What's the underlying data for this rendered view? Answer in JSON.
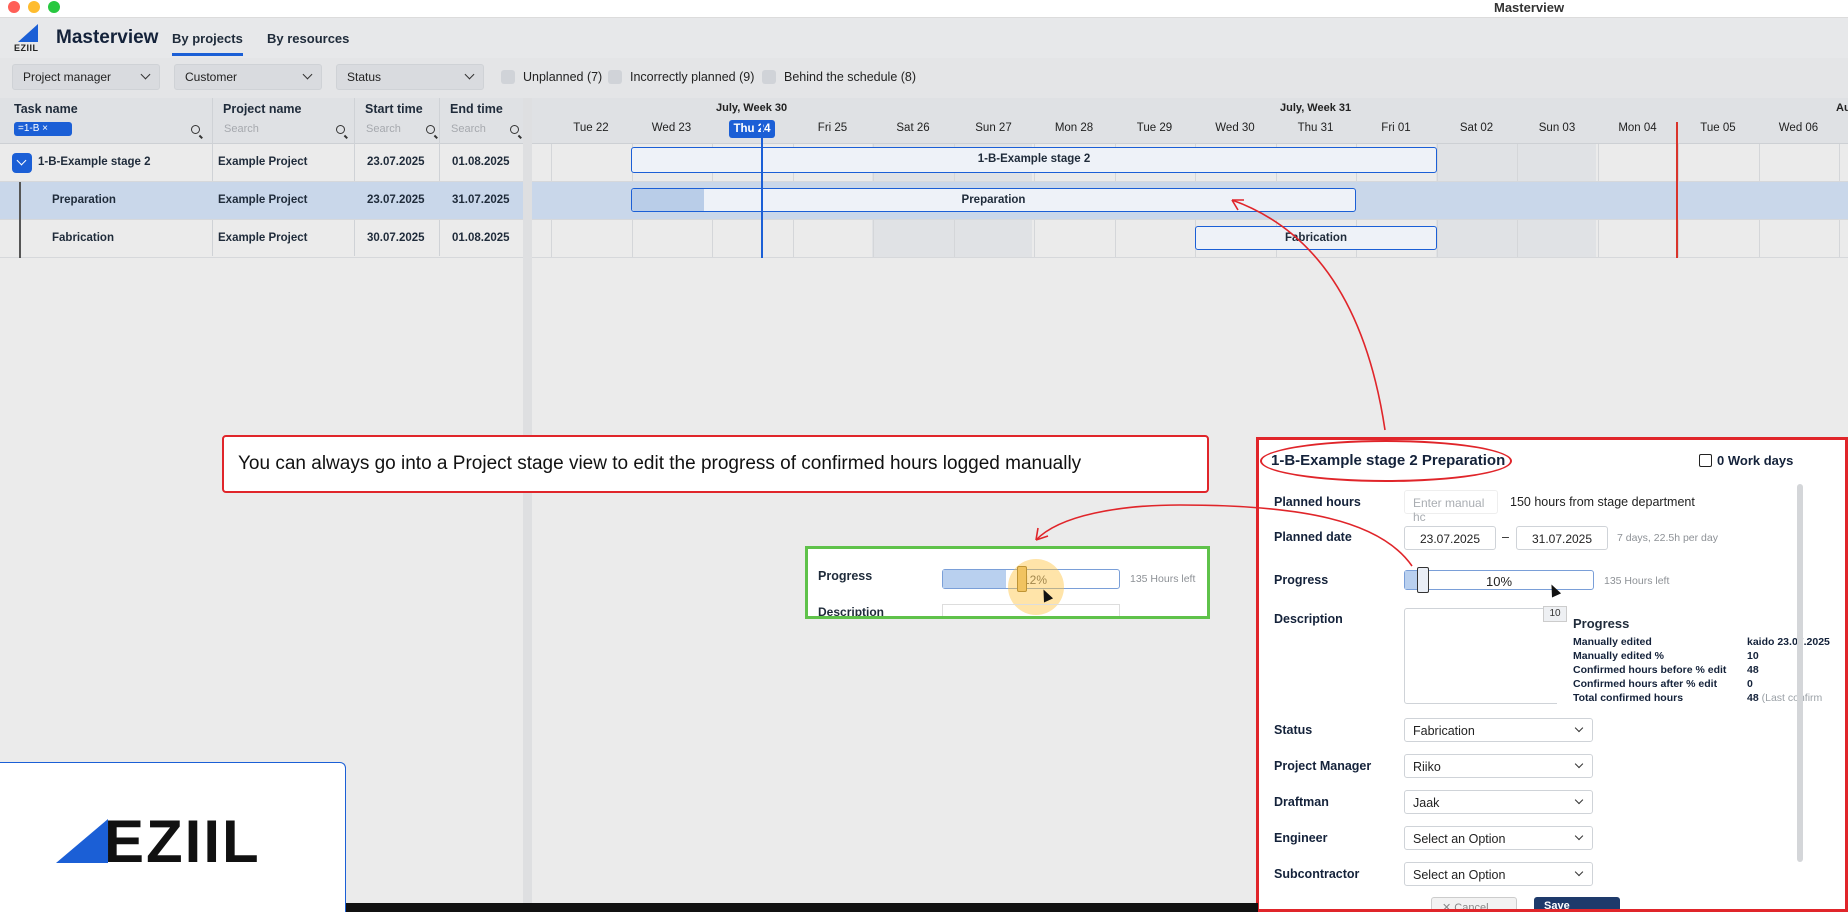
{
  "window": {
    "title": "Masterview"
  },
  "app": {
    "logo_text": "EZIIL",
    "title": "Masterview",
    "tabs": [
      "By projects",
      "By resources"
    ]
  },
  "filters": {
    "project_manager": "Project manager",
    "customer": "Customer",
    "status": "Status",
    "checks": [
      "Unplanned (7)",
      "Incorrectly planned (9)",
      "Behind the schedule (8)"
    ]
  },
  "grid": {
    "columns": [
      "Task name",
      "Project name",
      "Start time",
      "End time"
    ],
    "search_placeholder": "Search",
    "task_filter_chip": "=1-B  ×",
    "rows": [
      {
        "task": "1-B-Example stage 2",
        "project": "Example Project",
        "start": "23.07.2025",
        "end": "01.08.2025"
      },
      {
        "task": "Preparation",
        "project": "Example Project",
        "start": "23.07.2025",
        "end": "31.07.2025"
      },
      {
        "task": "Fabrication",
        "project": "Example Project",
        "start": "30.07.2025",
        "end": "01.08.2025"
      }
    ]
  },
  "timeline": {
    "weeks": [
      "July, Week 30",
      "July, Week 31",
      "Au"
    ],
    "days": [
      "Tue 22",
      "Wed 23",
      "Thu 24",
      "Fri 25",
      "Sat 26",
      "Sun 27",
      "Mon 28",
      "Tue 29",
      "Wed 30",
      "Thu 31",
      "Fri 01",
      "Sat 02",
      "Sun 03",
      "Mon 04",
      "Tue 05",
      "Wed 06"
    ],
    "today": "Thu 24",
    "bars": [
      {
        "label": "1-B-Example stage 2",
        "progress": 0
      },
      {
        "label": "Preparation",
        "progress": 10
      },
      {
        "label": "Fabrication",
        "progress": 0
      }
    ]
  },
  "callout": {
    "text": "You can always go into a Project stage view to edit the progress of confirmed hours logged manually"
  },
  "zoom": {
    "progress_label": "Progress",
    "progress_text": "12%",
    "progress_value": 12,
    "hours_left": "135 Hours left",
    "description_label": "Description"
  },
  "brand": {
    "logo_text": "EZIIL"
  },
  "panel": {
    "title": "1-B-Example stage 2 Preparation",
    "work_days": "0 Work days",
    "planned_hours_label": "Planned hours",
    "planned_hours_placeholder": "Enter manual hc",
    "planned_hours_note": "150 hours from stage department",
    "planned_date_label": "Planned date",
    "date_from": "23.07.2025",
    "date_sep": "–",
    "date_to": "31.07.2025",
    "date_note": "7 days, 22.5h per day",
    "progress_label": "Progress",
    "progress_text": "10%",
    "progress_value": 10,
    "hours_left": "135 Hours left",
    "slider_tip": "10",
    "description_label": "Description",
    "tooltip": {
      "title": "Progress",
      "rows": [
        {
          "label": "Manually edited",
          "value": "kaido 23.07.2025",
          "note": ""
        },
        {
          "label": "Manually edited %",
          "value": "10",
          "note": ""
        },
        {
          "label": "Confirmed hours before % edit",
          "value": "48",
          "note": ""
        },
        {
          "label": "Confirmed hours after % edit",
          "value": "0",
          "note": ""
        },
        {
          "label": "Total confirmed hours",
          "value": "48",
          "note": "(Last confirm"
        }
      ]
    },
    "fields": [
      {
        "label": "Status",
        "value": "Fabrication"
      },
      {
        "label": "Project Manager",
        "value": "Riiko"
      },
      {
        "label": "Draftman",
        "value": "Jaak"
      },
      {
        "label": "Engineer",
        "value": "Select an Option"
      },
      {
        "label": "Subcontractor",
        "value": "Select an Option"
      }
    ],
    "cancel_label": "✕ Cancel",
    "save_label": "Save"
  },
  "colors": {
    "accent": "#1b5fd6",
    "annotation_red": "#e0252a",
    "annotation_green": "#5fc24a"
  }
}
